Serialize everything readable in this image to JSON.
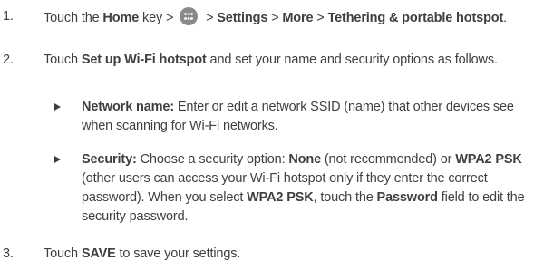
{
  "steps": [
    {
      "number": "1.",
      "parts": {
        "a": "Touch the ",
        "b": "Home",
        "c": " key > ",
        "d": " > ",
        "e": "Settings",
        "f": " > ",
        "g": "More",
        "h": " > ",
        "i": "Tethering & portable hotspot",
        "j": "."
      }
    },
    {
      "number": "2.",
      "parts": {
        "a": "Touch ",
        "b": "Set up Wi-Fi hotspot",
        "c": " and set your name and security options as follows."
      }
    },
    {
      "number": "3.",
      "parts": {
        "a": "Touch ",
        "b": "SAVE",
        "c": " to save your settings."
      }
    }
  ],
  "bullets": [
    {
      "parts": {
        "a": "Network name:",
        "b": " Enter or edit a network SSID (name) that other devices see when scanning for Wi-Fi networks."
      }
    },
    {
      "parts": {
        "a": "Security:",
        "b": " Choose a security option: ",
        "c": "None",
        "d": " (not recommended) or ",
        "e": "WPA2 PSK",
        "f": " (other users can access your Wi-Fi hotspot only if they enter the correct password). When you select ",
        "g": "WPA2 PSK",
        "h": ", touch the ",
        "i": "Password",
        "j": " field to edit the security password."
      }
    }
  ],
  "icons": {
    "apps": "apps-grid-icon",
    "bullet": "triangle-bullet-icon"
  }
}
